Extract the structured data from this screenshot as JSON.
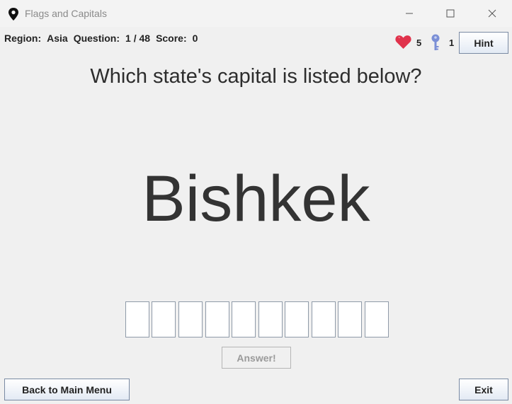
{
  "window": {
    "title": "Flags and Capitals"
  },
  "status": {
    "region_label": "Region:",
    "region_value": "Asia",
    "question_label": "Question:",
    "question_value": "1 / 48",
    "score_label": "Score:",
    "score_value": "0",
    "lives": "5",
    "hints": "1"
  },
  "buttons": {
    "hint": "Hint",
    "answer": "Answer!",
    "back": "Back to Main Menu",
    "exit": "Exit"
  },
  "question": {
    "prompt": "Which state's capital is listed below?",
    "capital": "Bishkek"
  },
  "answer_boxes": [
    "",
    "",
    "",
    "",
    "",
    "",
    "",
    "",
    "",
    ""
  ],
  "colors": {
    "heart": "#e0324b",
    "key": "#7b8fd6",
    "background": "#f0f0f0"
  },
  "icons": {
    "app": "map-pin-icon",
    "lives": "heart-icon",
    "hints": "key-icon"
  }
}
